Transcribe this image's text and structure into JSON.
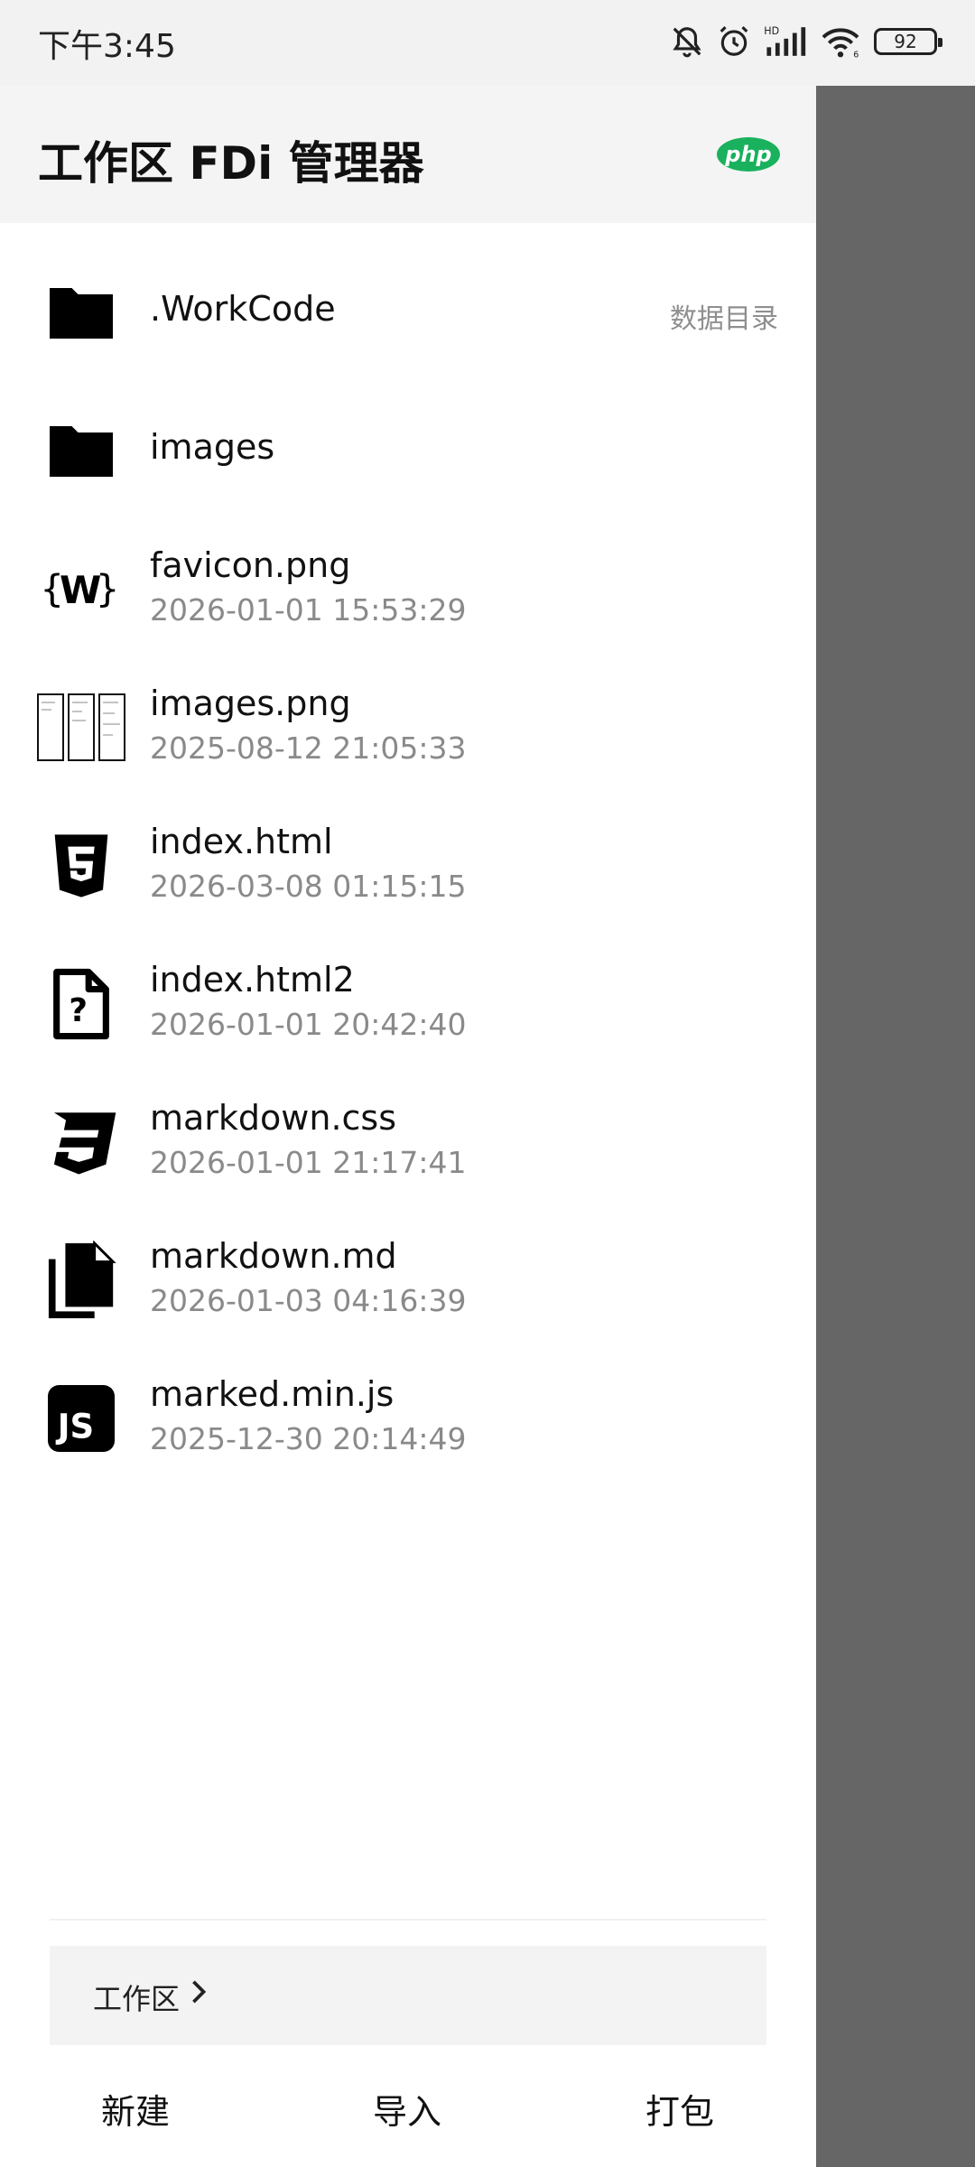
{
  "status": {
    "time": "下午3:45",
    "battery": "92",
    "icons": [
      "bell-off-icon",
      "alarm-icon",
      "hd-signal-icon",
      "wifi-icon",
      "battery-icon"
    ]
  },
  "drawer": {
    "title": "工作区 FDi 管理器",
    "badge": "php",
    "files": [
      {
        "name": ".WorkCode",
        "tag": "数据目录",
        "icon": "folder-icon"
      },
      {
        "name": "images",
        "icon": "folder-icon"
      },
      {
        "name": "favicon.png",
        "date": "2026-01-01 15:53:29",
        "icon": "favicon-icon"
      },
      {
        "name": "images.png",
        "date": "2025-08-12 21:05:33",
        "icon": "image-thumbnail-icon"
      },
      {
        "name": "index.html",
        "date": "2026-03-08 01:15:15",
        "icon": "html5-icon"
      },
      {
        "name": "index.html2",
        "date": "2026-01-01 20:42:40",
        "icon": "unknown-file-icon"
      },
      {
        "name": "markdown.css",
        "date": "2026-01-01 21:17:41",
        "icon": "css3-icon"
      },
      {
        "name": "markdown.md",
        "date": "2026-01-03 04:16:39",
        "icon": "copy-document-icon"
      },
      {
        "name": "marked.min.js",
        "date": "2025-12-30 20:14:49",
        "icon": "js-icon"
      }
    ],
    "workspace": "工作区",
    "actions": {
      "new": "新建",
      "import": "导入",
      "pack": "打包"
    }
  },
  "colors": {
    "badge": "#19b15d",
    "overlay": "#666666",
    "header": "#f4f4f4"
  }
}
